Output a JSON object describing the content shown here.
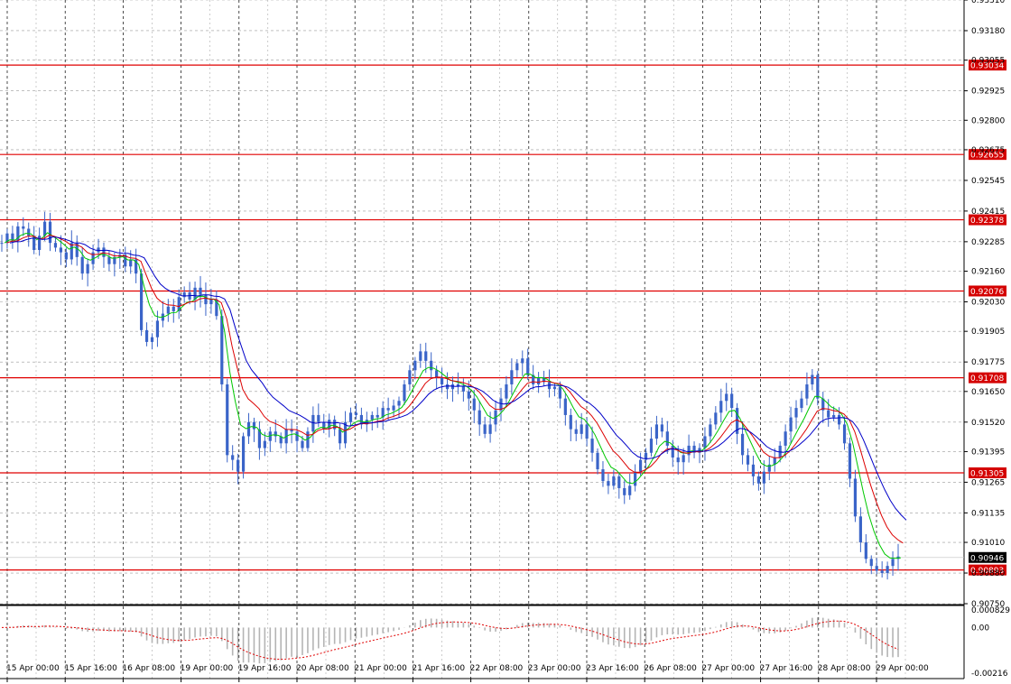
{
  "chart_data": {
    "type": "candlestick",
    "price_axis": {
      "ticks": [
        "0.93310",
        "0.93180",
        "0.93055",
        "0.92925",
        "0.92800",
        "0.92675",
        "0.92545",
        "0.92415",
        "0.92285",
        "0.92160",
        "0.92030",
        "0.91905",
        "0.91775",
        "0.91650",
        "0.91520",
        "0.91395",
        "0.91265",
        "0.91135",
        "0.91010",
        "0.90880",
        "0.90750"
      ],
      "ylim": [
        0.9075,
        0.9331
      ]
    },
    "time_axis": {
      "labels": [
        "15 Apr 00:00",
        "15 Apr 16:00",
        "16 Apr 08:00",
        "19 Apr 00:00",
        "19 Apr 16:00",
        "20 Apr 08:00",
        "21 Apr 00:00",
        "21 Apr 16:00",
        "22 Apr 08:00",
        "23 Apr 00:00",
        "23 Apr 16:00",
        "26 Apr 08:00",
        "27 Apr 00:00",
        "27 Apr 16:00",
        "28 Apr 08:00",
        "29 Apr 00:00"
      ]
    },
    "horizontal_levels": [
      "0.93034",
      "0.92655",
      "0.92378",
      "0.92076",
      "0.91708",
      "0.91305",
      "0.90893"
    ],
    "current_price": "0.90946",
    "closes": [
      0.9228,
      0.9232,
      0.9229,
      0.9235,
      0.9234,
      0.9231,
      0.9225,
      0.9231,
      0.9237,
      0.9228,
      0.9226,
      0.9224,
      0.9221,
      0.9228,
      0.9222,
      0.9215,
      0.9219,
      0.9224,
      0.9226,
      0.9222,
      0.9219,
      0.9222,
      0.9223,
      0.9218,
      0.9221,
      0.9215,
      0.9191,
      0.9186,
      0.9188,
      0.9195,
      0.9198,
      0.9201,
      0.9199,
      0.9205,
      0.9207,
      0.9204,
      0.9209,
      0.9206,
      0.9202,
      0.9204,
      0.9197,
      0.9168,
      0.9138,
      0.9136,
      0.9131,
      0.9146,
      0.9152,
      0.9149,
      0.9141,
      0.9144,
      0.9148,
      0.9146,
      0.9143,
      0.9149,
      0.9148,
      0.9144,
      0.9141,
      0.9148,
      0.9155,
      0.9152,
      0.9149,
      0.9153,
      0.9149,
      0.9143,
      0.9152,
      0.9156,
      0.9155,
      0.9151,
      0.9153,
      0.9155,
      0.9154,
      0.9158,
      0.9157,
      0.9159,
      0.9161,
      0.9168,
      0.9174,
      0.9178,
      0.9182,
      0.9178,
      0.9174,
      0.9171,
      0.9168,
      0.9166,
      0.9168,
      0.9167,
      0.9165,
      0.9162,
      0.9157,
      0.9151,
      0.9147,
      0.9151,
      0.9157,
      0.9162,
      0.9168,
      0.9174,
      0.9177,
      0.9179,
      0.9172,
      0.9168,
      0.9171,
      0.9169,
      0.9166,
      0.9167,
      0.9162,
      0.9155,
      0.9149,
      0.9147,
      0.9151,
      0.9145,
      0.9139,
      0.9132,
      0.9127,
      0.9125,
      0.9129,
      0.9124,
      0.9121,
      0.9125,
      0.9131,
      0.9136,
      0.9139,
      0.9145,
      0.9151,
      0.9148,
      0.9142,
      0.9137,
      0.9135,
      0.9138,
      0.9142,
      0.9139,
      0.9141,
      0.9146,
      0.9151,
      0.9156,
      0.9161,
      0.9164,
      0.9158,
      0.9147,
      0.9138,
      0.9134,
      0.9129,
      0.9126,
      0.9131,
      0.9134,
      0.9137,
      0.9142,
      0.9148,
      0.9154,
      0.9158,
      0.9162,
      0.9168,
      0.9172,
      0.9162,
      0.9157,
      0.9154,
      0.9155,
      0.9151,
      0.9143,
      0.9128,
      0.9112,
      0.9101,
      0.9094,
      0.9091,
      0.9089,
      0.9088,
      0.9091,
      0.9094,
      0.9095
    ]
  },
  "macd": {
    "ticks": [
      "0.000829",
      "0.00",
      "-0.00216"
    ]
  },
  "colors": {
    "grid": "#9a9a9a",
    "candle": "#3a64c8",
    "ma_fast": "#00c800",
    "ma_mid": "#dc0000",
    "ma_slow": "#0000c8",
    "level": "#e00000",
    "level_tag": "#d40000",
    "current_tag": "#000000",
    "histogram": "#b4b4b4",
    "signal": "#e00000"
  }
}
